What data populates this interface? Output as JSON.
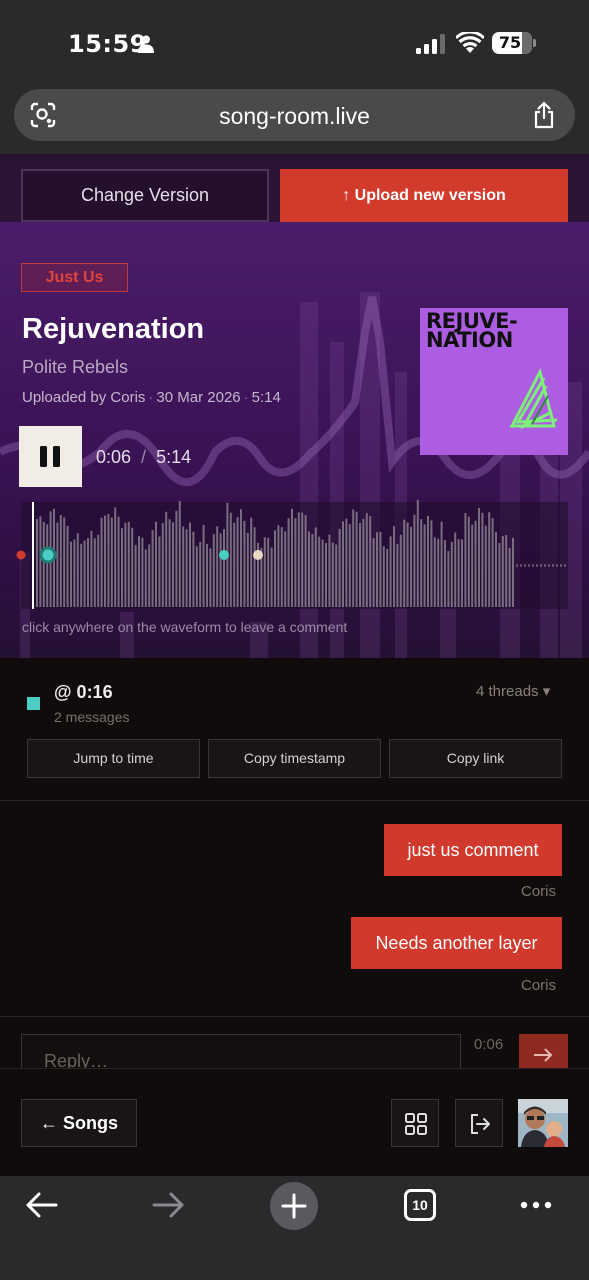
{
  "status_bar": {
    "time": "15:59",
    "battery": "75"
  },
  "browser": {
    "url": "song-room.live",
    "tabs_count": "10"
  },
  "toolbar": {
    "change_version": "Change Version",
    "upload_label": "↑  Upload new version"
  },
  "song": {
    "tag": "Just Us",
    "title": "Rejuvenation",
    "artist": "Polite Rebels",
    "uploaded_by": "Uploaded by Coris",
    "date": "30 Mar 2026",
    "duration": "5:14",
    "cover_text_1": "REJUVE-",
    "cover_text_2": "NATION"
  },
  "player": {
    "current_time": "0:06",
    "total_time": "5:14",
    "progress": 0.019,
    "state": "playing"
  },
  "waveform": {
    "hint": "click anywhere on the waveform to leave a comment",
    "comment_markers": [
      {
        "color": "#d23a2c"
      },
      {
        "color": "#4ecdc4"
      },
      {
        "color": "#4ecdc4"
      },
      {
        "color": "#e8d8c4"
      }
    ]
  },
  "thread": {
    "timestamp": "@ 0:16",
    "message_count": "2 messages",
    "threads_label": "4 threads ▾",
    "marker_color": "#4ecdc4",
    "actions": {
      "jump": "Jump to time",
      "copy_ts": "Copy timestamp",
      "copy_link": "Copy link"
    },
    "messages": [
      {
        "text": "just us comment",
        "author": "Coris"
      },
      {
        "text": "Needs another layer",
        "author": "Coris"
      }
    ],
    "reply": {
      "placeholder": "Reply…",
      "time": "0:06"
    }
  },
  "app_bar": {
    "songs_label": "← Songs"
  },
  "colors": {
    "accent": "#d23a2c",
    "hero": "#3d1458",
    "teal": "#4ecdc4"
  }
}
